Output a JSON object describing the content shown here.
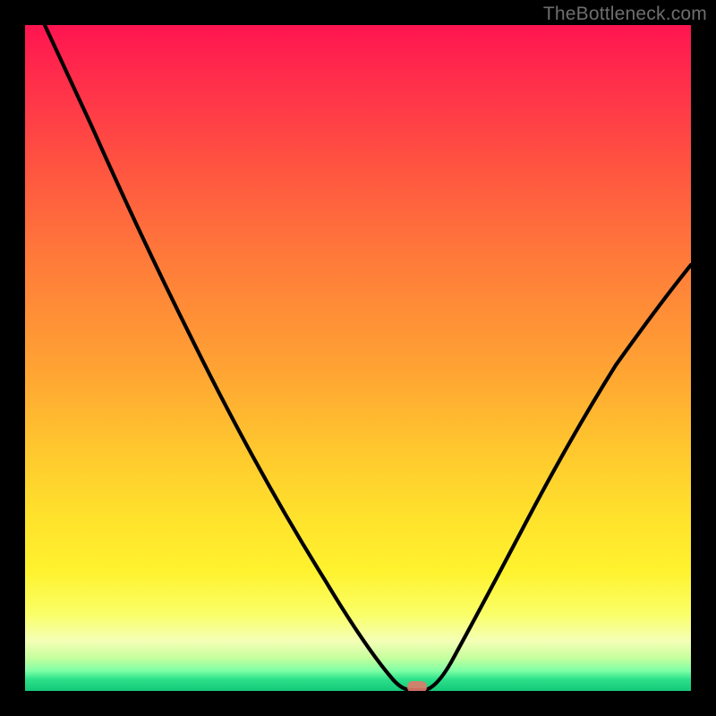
{
  "watermark": "TheBottleneck.com",
  "chart_data": {
    "type": "line",
    "title": "",
    "xlabel": "",
    "ylabel": "",
    "xlim": [
      0,
      100
    ],
    "ylim": [
      0,
      100
    ],
    "grid": false,
    "legend": false,
    "background": "vertical-gradient red→orange→yellow→green",
    "series": [
      {
        "name": "bottleneck-curve",
        "x": [
          3,
          10,
          18,
          25,
          32,
          38,
          44,
          49,
          53,
          55,
          57,
          58.5,
          60,
          64,
          70,
          78,
          86,
          94,
          100
        ],
        "y": [
          100,
          85,
          67,
          53,
          40,
          29,
          19,
          10,
          4,
          1.2,
          0,
          0,
          0.2,
          4,
          13,
          27,
          42,
          55,
          64
        ]
      }
    ],
    "marker": {
      "x": 58.5,
      "y": 0,
      "shape": "rounded-rect",
      "color": "#e07a6a"
    }
  }
}
